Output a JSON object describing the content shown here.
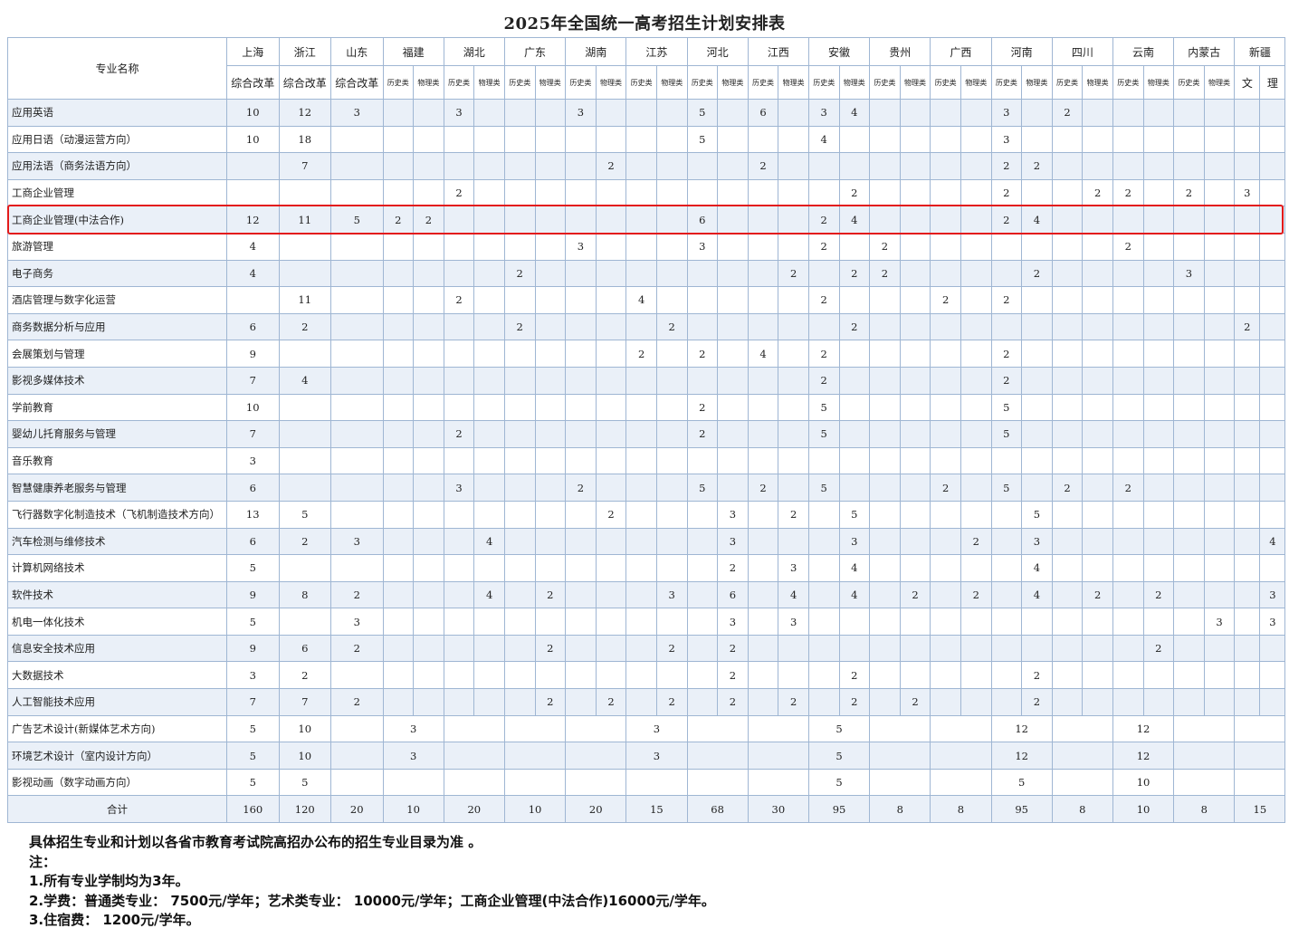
{
  "title": "2025年全国统一高考招生计划安排表",
  "header": {
    "corner": "专业名称",
    "provinces": [
      {
        "name": "上海",
        "subs": [
          "综合改革"
        ]
      },
      {
        "name": "浙江",
        "subs": [
          "综合改革"
        ]
      },
      {
        "name": "山东",
        "subs": [
          "综合改革"
        ]
      },
      {
        "name": "福建",
        "subs": [
          "历史类",
          "物理类"
        ]
      },
      {
        "name": "湖北",
        "subs": [
          "历史类",
          "物理类"
        ]
      },
      {
        "name": "广东",
        "subs": [
          "历史类",
          "物理类"
        ]
      },
      {
        "name": "湖南",
        "subs": [
          "历史类",
          "物理类"
        ]
      },
      {
        "name": "江苏",
        "subs": [
          "历史类",
          "物理类"
        ]
      },
      {
        "name": "河北",
        "subs": [
          "历史类",
          "物理类"
        ]
      },
      {
        "name": "江西",
        "subs": [
          "历史类",
          "物理类"
        ]
      },
      {
        "name": "安徽",
        "subs": [
          "历史类",
          "物理类"
        ]
      },
      {
        "name": "贵州",
        "subs": [
          "历史类",
          "物理类"
        ]
      },
      {
        "name": "广西",
        "subs": [
          "历史类",
          "物理类"
        ]
      },
      {
        "name": "河南",
        "subs": [
          "历史类",
          "物理类"
        ]
      },
      {
        "name": "四川",
        "subs": [
          "历史类",
          "物理类"
        ]
      },
      {
        "name": "云南",
        "subs": [
          "历史类",
          "物理类"
        ]
      },
      {
        "name": "内蒙古",
        "subs": [
          "历史类",
          "物理类"
        ]
      },
      {
        "name": "新疆",
        "subs": [
          "文",
          "理"
        ]
      }
    ]
  },
  "rows": [
    {
      "name": "应用英语",
      "values": [
        "10",
        "12",
        "3",
        "",
        "",
        "3",
        "",
        "",
        "",
        "3",
        "",
        "",
        "",
        "5",
        "",
        "6",
        "",
        "3",
        "4",
        "",
        "",
        "",
        "",
        "3",
        "",
        "2",
        "",
        "",
        "",
        "",
        "",
        "",
        ""
      ]
    },
    {
      "name": "应用日语（动漫运营方向）",
      "values": [
        "10",
        "18",
        "",
        "",
        "",
        "",
        "",
        "",
        "",
        "",
        "",
        "",
        "",
        "5",
        "",
        "",
        "",
        "4",
        "",
        "",
        "",
        "",
        "",
        "3",
        "",
        "",
        "",
        "",
        "",
        "",
        "",
        "",
        ""
      ]
    },
    {
      "name": "应用法语（商务法语方向）",
      "values": [
        "",
        "7",
        "",
        "",
        "",
        "",
        "",
        "",
        "",
        "",
        "2",
        "",
        "",
        "",
        "",
        "2",
        "",
        "",
        "",
        "",
        "",
        "",
        "",
        "2",
        "2",
        "",
        "",
        "",
        "",
        "",
        "",
        "",
        ""
      ]
    },
    {
      "name": "工商企业管理",
      "values": [
        "",
        "",
        "",
        "",
        "",
        "2",
        "",
        "",
        "",
        "",
        "",
        "",
        "",
        "",
        "",
        "",
        "",
        "",
        "2",
        "",
        "",
        "",
        "",
        "2",
        "",
        "",
        "2",
        "2",
        "",
        "2",
        "",
        "3",
        ""
      ]
    },
    {
      "name": "工商企业管理(中法合作)",
      "values": [
        "12",
        "11",
        "5",
        "2",
        "2",
        "",
        "",
        "",
        "",
        "",
        "",
        "",
        "",
        "6",
        "",
        "",
        "",
        "2",
        "4",
        "",
        "",
        "",
        "",
        "2",
        "4",
        "",
        "",
        "",
        "",
        "",
        "",
        "",
        ""
      ]
    },
    {
      "name": "旅游管理",
      "values": [
        "4",
        "",
        "",
        "",
        "",
        "",
        "",
        "",
        "",
        "3",
        "",
        "",
        "",
        "3",
        "",
        "",
        "",
        "2",
        "",
        "2",
        "",
        "",
        "",
        "",
        "",
        "",
        "",
        "2",
        "",
        "",
        "",
        "",
        ""
      ]
    },
    {
      "name": "电子商务",
      "values": [
        "4",
        "",
        "",
        "",
        "",
        "",
        "",
        "2",
        "",
        "",
        "",
        "",
        "",
        "",
        "",
        "",
        "2",
        "",
        "2",
        "2",
        "",
        "",
        "",
        "",
        "2",
        "",
        "",
        "",
        "",
        "3",
        "",
        "",
        ""
      ]
    },
    {
      "name": "酒店管理与数字化运营",
      "values": [
        "",
        "11",
        "",
        "",
        "",
        "2",
        "",
        "",
        "",
        "",
        "",
        "4",
        "",
        "",
        "",
        "",
        "",
        "2",
        "",
        "",
        "",
        "2",
        "",
        "2",
        "",
        "",
        "",
        "",
        "",
        "",
        "",
        "",
        ""
      ]
    },
    {
      "name": "商务数据分析与应用",
      "values": [
        "6",
        "2",
        "",
        "",
        "",
        "",
        "",
        "2",
        "",
        "",
        "",
        "",
        "2",
        "",
        "",
        "",
        "",
        "",
        "2",
        "",
        "",
        "",
        "",
        "",
        "",
        "",
        "",
        "",
        "",
        "",
        "",
        "2",
        ""
      ]
    },
    {
      "name": "会展策划与管理",
      "values": [
        "9",
        "",
        "",
        "",
        "",
        "",
        "",
        "",
        "",
        "",
        "",
        "2",
        "",
        "2",
        "",
        "4",
        "",
        "2",
        "",
        "",
        "",
        "",
        "",
        "2",
        "",
        "",
        "",
        "",
        "",
        "",
        "",
        "",
        ""
      ]
    },
    {
      "name": "影视多媒体技术",
      "values": [
        "7",
        "4",
        "",
        "",
        "",
        "",
        "",
        "",
        "",
        "",
        "",
        "",
        "",
        "",
        "",
        "",
        "",
        "2",
        "",
        "",
        "",
        "",
        "",
        "2",
        "",
        "",
        "",
        "",
        "",
        "",
        "",
        "",
        ""
      ]
    },
    {
      "name": "学前教育",
      "values": [
        "10",
        "",
        "",
        "",
        "",
        "",
        "",
        "",
        "",
        "",
        "",
        "",
        "",
        "2",
        "",
        "",
        "",
        "5",
        "",
        "",
        "",
        "",
        "",
        "5",
        "",
        "",
        "",
        "",
        "",
        "",
        "",
        "",
        ""
      ]
    },
    {
      "name": "婴幼儿托育服务与管理",
      "values": [
        "7",
        "",
        "",
        "",
        "",
        "2",
        "",
        "",
        "",
        "",
        "",
        "",
        "",
        "2",
        "",
        "",
        "",
        "5",
        "",
        "",
        "",
        "",
        "",
        "5",
        "",
        "",
        "",
        "",
        "",
        "",
        "",
        "",
        ""
      ]
    },
    {
      "name": "音乐教育",
      "values": [
        "3",
        "",
        "",
        "",
        "",
        "",
        "",
        "",
        "",
        "",
        "",
        "",
        "",
        "",
        "",
        "",
        "",
        "",
        "",
        "",
        "",
        "",
        "",
        "",
        "",
        "",
        "",
        "",
        "",
        "",
        "",
        "",
        ""
      ]
    },
    {
      "name": "智慧健康养老服务与管理",
      "values": [
        "6",
        "",
        "",
        "",
        "",
        "3",
        "",
        "",
        "",
        "2",
        "",
        "",
        "",
        "5",
        "",
        "2",
        "",
        "5",
        "",
        "",
        "",
        "2",
        "",
        "5",
        "",
        "2",
        "",
        "2",
        "",
        "",
        "",
        "",
        ""
      ]
    },
    {
      "name": "飞行器数字化制造技术（飞机制造技术方向）",
      "values": [
        "13",
        "5",
        "",
        "",
        "",
        "",
        "",
        "",
        "",
        "",
        "2",
        "",
        "",
        "",
        "3",
        "",
        "2",
        "",
        "5",
        "",
        "",
        "",
        "",
        "",
        "5",
        "",
        "",
        "",
        "",
        "",
        "",
        "",
        ""
      ]
    },
    {
      "name": "汽车检测与维修技术",
      "values": [
        "6",
        "2",
        "3",
        "",
        "",
        "",
        "4",
        "",
        "",
        "",
        "",
        "",
        "",
        "",
        "3",
        "",
        "",
        "",
        "3",
        "",
        "",
        "",
        "2",
        "",
        "3",
        "",
        "",
        "",
        "",
        "",
        "",
        "",
        "4"
      ]
    },
    {
      "name": "计算机网络技术",
      "values": [
        "5",
        "",
        "",
        "",
        "",
        "",
        "",
        "",
        "",
        "",
        "",
        "",
        "",
        "",
        "2",
        "",
        "3",
        "",
        "4",
        "",
        "",
        "",
        "",
        "",
        "4",
        "",
        "",
        "",
        "",
        "",
        "",
        "",
        ""
      ]
    },
    {
      "name": "软件技术",
      "values": [
        "9",
        "8",
        "2",
        "",
        "",
        "",
        "4",
        "",
        "2",
        "",
        "",
        "",
        "3",
        "",
        "6",
        "",
        "4",
        "",
        "4",
        "",
        "2",
        "",
        "2",
        "",
        "4",
        "",
        "2",
        "",
        "2",
        "",
        "",
        "",
        "3"
      ]
    },
    {
      "name": "机电一体化技术",
      "values": [
        "5",
        "",
        "3",
        "",
        "",
        "",
        "",
        "",
        "",
        "",
        "",
        "",
        "",
        "",
        "3",
        "",
        "3",
        "",
        "",
        "",
        "",
        "",
        "",
        "",
        "",
        "",
        "",
        "",
        "",
        "",
        "3",
        "",
        "3"
      ]
    },
    {
      "name": "信息安全技术应用",
      "values": [
        "9",
        "6",
        "2",
        "",
        "",
        "",
        "",
        "",
        "2",
        "",
        "",
        "",
        "2",
        "",
        "2",
        "",
        "",
        "",
        "",
        "",
        "",
        "",
        "",
        "",
        "",
        "",
        "",
        "",
        "2",
        "",
        "",
        "",
        ""
      ]
    },
    {
      "name": "大数据技术",
      "values": [
        "3",
        "2",
        "",
        "",
        "",
        "",
        "",
        "",
        "",
        "",
        "",
        "",
        "",
        "",
        "2",
        "",
        "",
        "",
        "2",
        "",
        "",
        "",
        "",
        "",
        "2",
        "",
        "",
        "",
        "",
        "",
        "",
        "",
        ""
      ]
    },
    {
      "name": "人工智能技术应用",
      "values": [
        "7",
        "7",
        "2",
        "",
        "",
        "",
        "",
        "",
        "2",
        "",
        "2",
        "",
        "2",
        "",
        "2",
        "",
        "2",
        "",
        "2",
        "",
        "2",
        "",
        "",
        "",
        "2",
        "",
        "",
        "",
        "",
        "",
        "",
        "",
        ""
      ]
    }
  ],
  "merged_rows": [
    {
      "name": "广告艺术设计(新媒体艺术方向)",
      "values": [
        "5",
        "10",
        "",
        "3",
        "",
        "",
        "",
        "3",
        "",
        "",
        "5",
        "",
        "",
        "12",
        "",
        "12",
        "",
        "",
        "",
        ""
      ]
    },
    {
      "name": "环境艺术设计（室内设计方向）",
      "values": [
        "5",
        "10",
        "",
        "3",
        "",
        "",
        "",
        "3",
        "",
        "",
        "5",
        "",
        "",
        "12",
        "",
        "12",
        "",
        "",
        "",
        ""
      ]
    },
    {
      "name": "影视动画（数字动画方向）",
      "values": [
        "5",
        "5",
        "",
        "",
        "",
        "",
        "",
        "",
        "",
        "",
        "5",
        "",
        "",
        "5",
        "",
        "10",
        "",
        "",
        "",
        ""
      ]
    }
  ],
  "total": {
    "label": "合计",
    "values": [
      "160",
      "120",
      "20",
      "10",
      "20",
      "10",
      "20",
      "15",
      "68",
      "30",
      "95",
      "8",
      "8",
      "95",
      "8",
      "10",
      "8",
      "15"
    ]
  },
  "notes": [
    "具体招生专业和计划以各省市教育考试院高招办公布的招生专业目录为准 。",
    "注：",
    "1.所有专业学制均为3年。",
    "2.学费：普通类专业： 7500元/学年；艺术类专业： 10000元/学年；工商企业管理(中法合作)16000元/学年。",
    "3.住宿费： 1200元/学年。"
  ],
  "colors": {
    "highlight": "#e31a1a",
    "band": "#eaf0f8",
    "border": "#9fb6d3"
  }
}
